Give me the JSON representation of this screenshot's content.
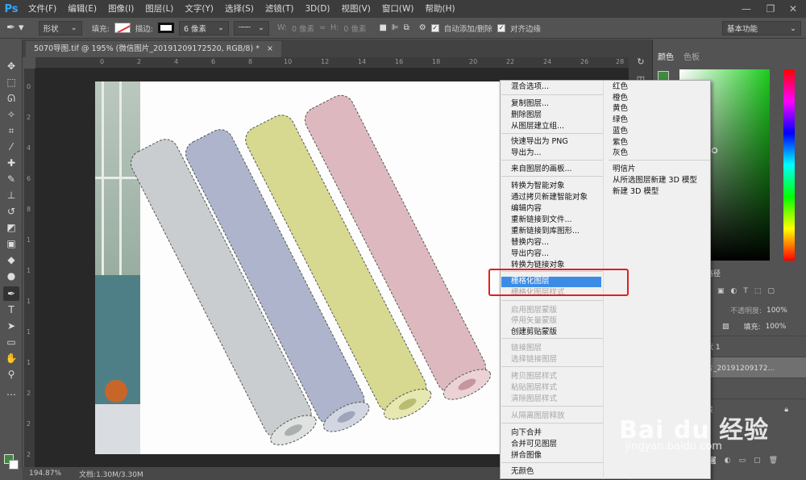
{
  "app": {
    "logo": "Ps"
  },
  "menubar": {
    "items": [
      "文件(F)",
      "编辑(E)",
      "图像(I)",
      "图层(L)",
      "文字(Y)",
      "选择(S)",
      "滤镜(T)",
      "3D(D)",
      "视图(V)",
      "窗口(W)",
      "帮助(H)"
    ]
  },
  "options": {
    "tool_mode": "形状",
    "fill_label": "填充:",
    "stroke_label": "描边:",
    "stroke_size": "6 像素",
    "w_label": "W:",
    "w_value": "0 像素",
    "h_label": "H:",
    "h_value": "0 像素",
    "auto_add_delete": "自动添加/删除",
    "align_edges": "对齐边缘",
    "workspace": "基本功能"
  },
  "document": {
    "tab_title": "5070导图.tif @ 195% (微信图片_20191209172520, RGB/8) *"
  },
  "ruler": {
    "h": [
      "0",
      "2",
      "4",
      "6",
      "8",
      "10",
      "12",
      "14",
      "16",
      "18",
      "20",
      "22",
      "24",
      "26",
      "28"
    ],
    "v": [
      "0",
      "2",
      "4",
      "6",
      "8",
      "1",
      "1",
      "1",
      "1",
      "1",
      "2",
      "2",
      "2",
      "2"
    ]
  },
  "status": {
    "zoom": "194.87%",
    "doc": "文档:1.30M/3.30M"
  },
  "color_panel": {
    "tab_color": "颜色",
    "tab_swatches": "色板"
  },
  "layers_panel": {
    "tab_paths": "路径",
    "opacity_label": "不透明度:",
    "opacity": "100%",
    "fill_label": "填充:",
    "fill": "100%",
    "layers": [
      "状 1",
      "片_20191209172...",
      "1",
      "景"
    ]
  },
  "context_menu": {
    "main": [
      {
        "label": "混合选项...",
        "disabled": false
      },
      {
        "label": "复制图层...",
        "disabled": false
      },
      {
        "label": "删除图层",
        "disabled": false
      },
      {
        "label": "从图层建立组...",
        "disabled": false
      },
      {
        "label": "快速导出为 PNG",
        "disabled": false
      },
      {
        "label": "导出为...",
        "disabled": false
      },
      {
        "label": "来自图层的画板...",
        "disabled": false
      },
      {
        "label": "转换为智能对象",
        "disabled": false
      },
      {
        "label": "通过拷贝新建智能对象",
        "disabled": false
      },
      {
        "label": "编辑内容",
        "disabled": false
      },
      {
        "label": "重新链接到文件...",
        "disabled": false
      },
      {
        "label": "重新链接到库图形...",
        "disabled": false
      },
      {
        "label": "替换内容...",
        "disabled": false
      },
      {
        "label": "导出内容...",
        "disabled": false
      },
      {
        "label": "转换为链接对象",
        "disabled": false
      },
      {
        "label": "栅格化图层",
        "disabled": false,
        "highlighted": true
      },
      {
        "label": "栅格化图层样式",
        "disabled": true
      },
      {
        "label": "启用图层蒙版",
        "disabled": true
      },
      {
        "label": "停用矢量蒙版",
        "disabled": true
      },
      {
        "label": "创建剪贴蒙版",
        "disabled": false
      },
      {
        "label": "链接图层",
        "disabled": true
      },
      {
        "label": "选择链接图层",
        "disabled": true
      },
      {
        "label": "拷贝图层样式",
        "disabled": true
      },
      {
        "label": "粘贴图层样式",
        "disabled": true
      },
      {
        "label": "清除图层样式",
        "disabled": true
      },
      {
        "label": "从隔离图层释放",
        "disabled": true
      },
      {
        "label": "向下合并",
        "disabled": false
      },
      {
        "label": "合并可见图层",
        "disabled": false
      },
      {
        "label": "拼合图像",
        "disabled": false
      },
      {
        "label": "无颜色",
        "disabled": false
      }
    ],
    "colors": [
      "红色",
      "橙色",
      "黄色",
      "绿色",
      "蓝色",
      "紫色",
      "灰色"
    ],
    "sub": [
      "明信片",
      "从所选图层新建 3D 模型",
      "新建 3D 模型"
    ]
  },
  "watermark": {
    "brand": "Bai du 经验",
    "url": "jingyan.baidu.com"
  },
  "colors": {
    "highlight": "#3c8ce6",
    "annotation_box": "#e02020",
    "foreground": "#3e8a3e"
  }
}
